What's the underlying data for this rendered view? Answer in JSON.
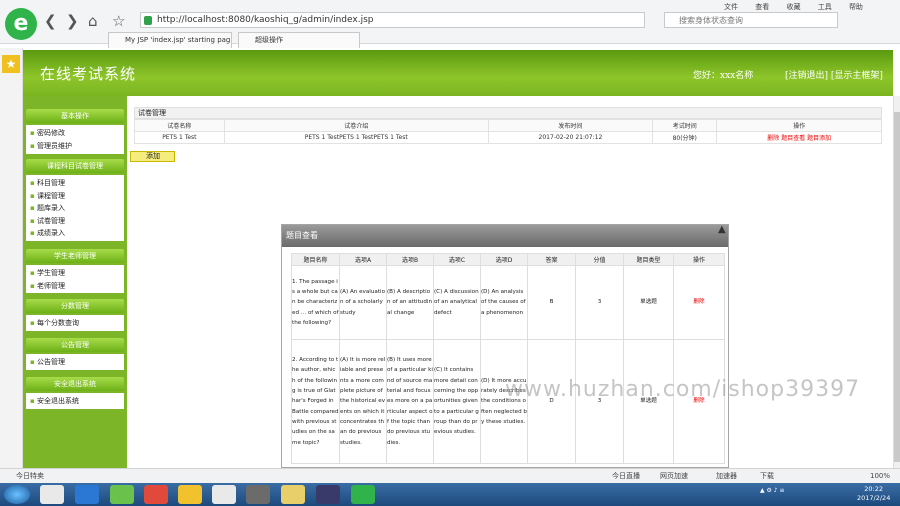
{
  "browser": {
    "address": "http://localhost:8080/kaoshiq_g/admin/index.jsp",
    "search_placeholder": "搜索身体状态查询",
    "menus": [
      "文件",
      "查看",
      "收藏",
      "工具",
      "帮助"
    ],
    "tabs": [
      "My JSP 'index.jsp' starting pag",
      "超级操作"
    ],
    "logo": "e"
  },
  "header": {
    "title": "在线考试系统",
    "greeting": "您好：xxx名称",
    "links": "[注销退出] [显示主框架]"
  },
  "sidebar": [
    {
      "title": "基本操作",
      "items": [
        "密码修改",
        "管理员维护"
      ]
    },
    {
      "title": "课程科目试卷管理",
      "items": [
        "科目管理",
        "课程管理",
        "题库录入",
        "试卷管理",
        "成绩录入"
      ]
    },
    {
      "title": "学生老师管理",
      "items": [
        "学生管理",
        "老师管理"
      ]
    },
    {
      "title": "分数管理",
      "items": [
        "每个分数查询"
      ]
    },
    {
      "title": "公告管理",
      "items": [
        "公告管理"
      ]
    },
    {
      "title": "安全退出系统",
      "items": [
        "安全退出系统"
      ]
    }
  ],
  "exam": {
    "section_title": "试卷管理",
    "headers": [
      "试卷名称",
      "试卷介绍",
      "发布时间",
      "考试时间",
      "操作"
    ],
    "row": [
      "PETS 1 Test",
      "PETS 1 TestPETS 1 TestPETS 1 Test",
      "2017-02-20 21:07:12",
      "80(分钟)",
      "删除 题目查看 题目添加"
    ],
    "add_label": "添加"
  },
  "modal": {
    "title": "题目查看",
    "headers": [
      "题目名称",
      "选项A",
      "选项B",
      "选项C",
      "选项D",
      "答案",
      "分值",
      "题目类型",
      "操作"
    ],
    "rows": [
      [
        "1. The passage is a whole but can be characterized ... of which of the following?",
        "(A) An evaluation of a scholarly study",
        "(B) A description of an attitudinal change",
        "(C) A discussion of an analytical defect",
        "(D) An analysis of the causes of a phenomenon",
        "B",
        "3",
        "单选题",
        "删除"
      ],
      [
        "2. According to the author, which of the following is true of Glathar's Forged in Battle compared with previous studies on the same topic?",
        "(A) It is more reliable and presents a more complete picture of the historical events on which it concentrates than do previous studies.",
        "(B) It uses more of a particular kind of source material and focuses more on a particular aspect of the topic than do previous studies.",
        "(C) It contains more detail concerning the opportunities given to a particular group than do previous studies.",
        "(D) It more accurately describes the conditions often neglected by these studies.",
        "D",
        "3",
        "单选题",
        "删除"
      ]
    ]
  },
  "status": {
    "left": "今日特卖",
    "items": [
      "今日直播",
      "网页加速",
      "加速器",
      "下载",
      "100%"
    ]
  },
  "taskbar": {
    "time": "20:22",
    "date": "2017/2/24"
  },
  "watermark": "www.huzhan.com/ishop39397"
}
